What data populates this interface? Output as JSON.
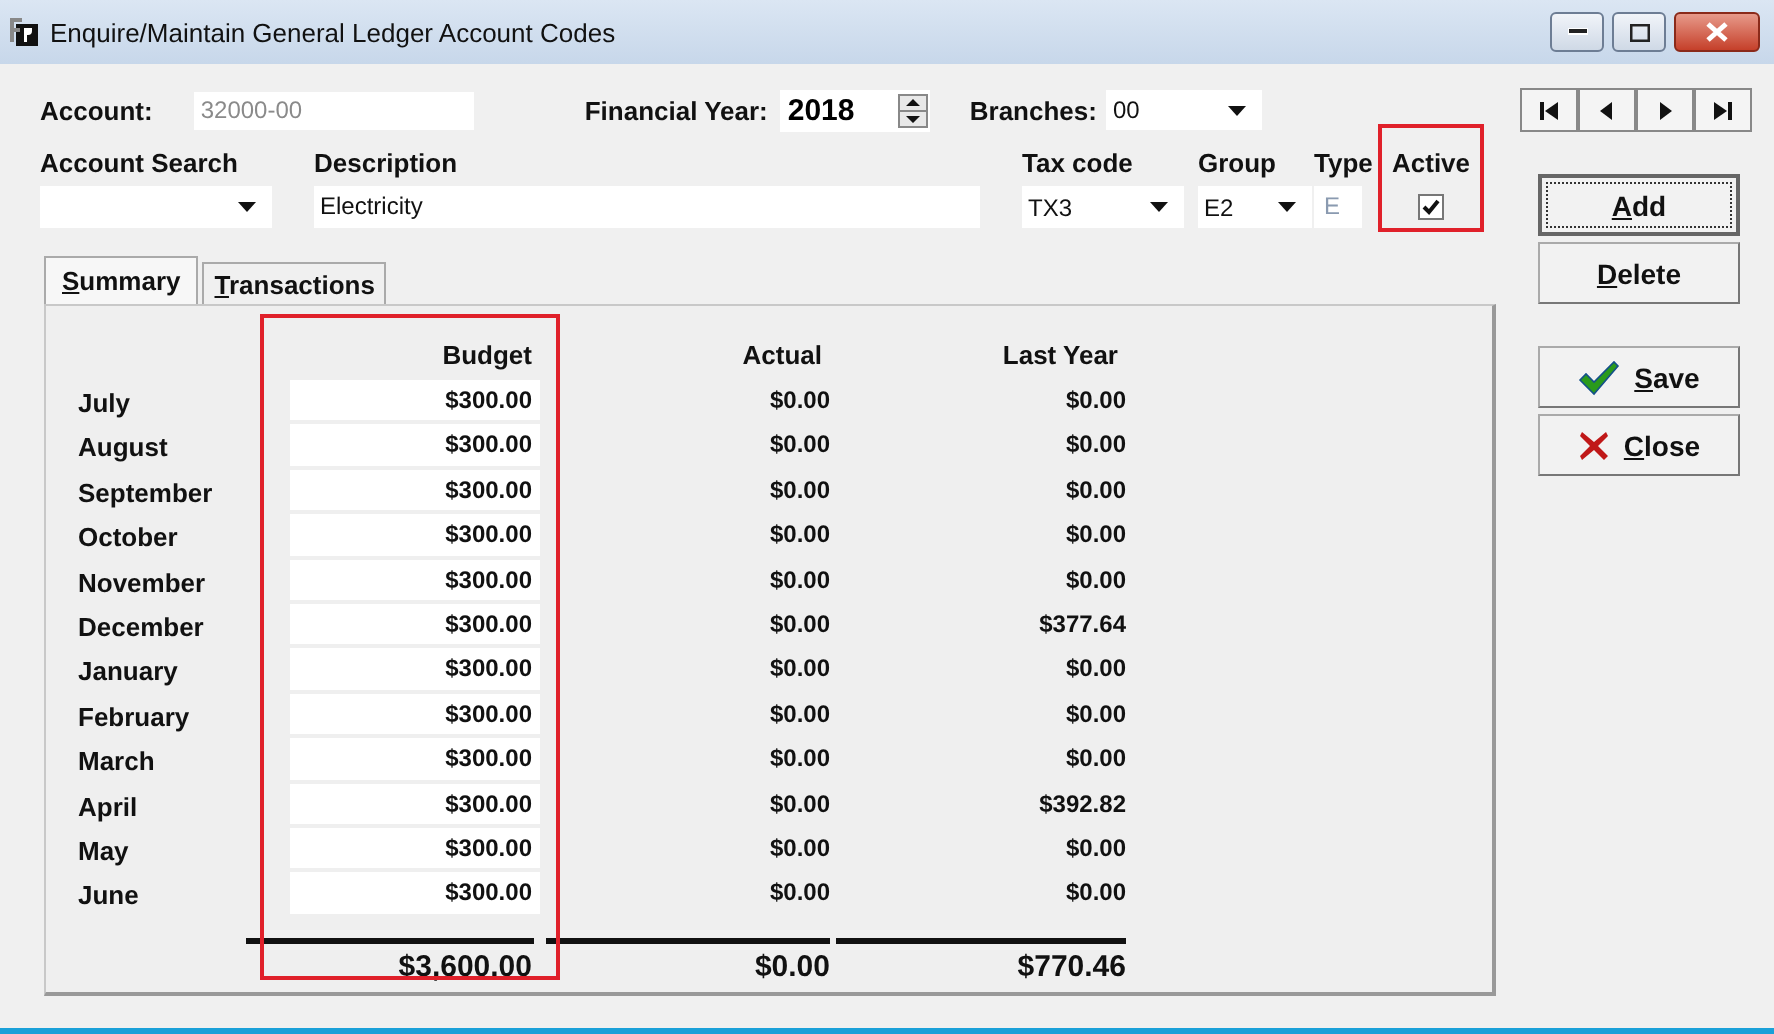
{
  "window": {
    "title": "Enquire/Maintain General Ledger Account Codes"
  },
  "header": {
    "account": {
      "label": "Account:",
      "value": "32000-00"
    },
    "financial_year": {
      "label": "Financial Year:",
      "value": "2018"
    },
    "branches": {
      "label": "Branches:",
      "value": "00"
    }
  },
  "fields": {
    "account_search": {
      "label": "Account Search"
    },
    "description": {
      "label": "Description",
      "value": "Electricity"
    },
    "tax_code": {
      "label": "Tax code",
      "value": "TX3"
    },
    "group": {
      "label": "Group",
      "value": "E2"
    },
    "type": {
      "label": "Type",
      "value": "E"
    },
    "active": {
      "label": "Active",
      "checked": true,
      "highlight": true
    }
  },
  "tabs": [
    {
      "label": "Summary",
      "selected": true
    },
    {
      "label": "Transactions",
      "selected": false
    }
  ],
  "table": {
    "columns": [
      "Budget",
      "Actual",
      "Last Year"
    ],
    "budget_highlight": true,
    "rows": [
      {
        "month": "July",
        "budget": "$300.00",
        "actual": "$0.00",
        "last_year": "$0.00"
      },
      {
        "month": "August",
        "budget": "$300.00",
        "actual": "$0.00",
        "last_year": "$0.00"
      },
      {
        "month": "September",
        "budget": "$300.00",
        "actual": "$0.00",
        "last_year": "$0.00"
      },
      {
        "month": "October",
        "budget": "$300.00",
        "actual": "$0.00",
        "last_year": "$0.00"
      },
      {
        "month": "November",
        "budget": "$300.00",
        "actual": "$0.00",
        "last_year": "$0.00"
      },
      {
        "month": "December",
        "budget": "$300.00",
        "actual": "$0.00",
        "last_year": "$377.64"
      },
      {
        "month": "January",
        "budget": "$300.00",
        "actual": "$0.00",
        "last_year": "$0.00"
      },
      {
        "month": "February",
        "budget": "$300.00",
        "actual": "$0.00",
        "last_year": "$0.00"
      },
      {
        "month": "March",
        "budget": "$300.00",
        "actual": "$0.00",
        "last_year": "$0.00"
      },
      {
        "month": "April",
        "budget": "$300.00",
        "actual": "$0.00",
        "last_year": "$392.82"
      },
      {
        "month": "May",
        "budget": "$300.00",
        "actual": "$0.00",
        "last_year": "$0.00"
      },
      {
        "month": "June",
        "budget": "$300.00",
        "actual": "$0.00",
        "last_year": "$0.00"
      }
    ],
    "totals": {
      "budget": "$3,600.00",
      "actual": "$0.00",
      "last_year": "$770.46"
    }
  },
  "buttons": [
    {
      "label": "Add",
      "kind": "plain",
      "focused": true
    },
    {
      "label": "Delete",
      "kind": "plain",
      "focused": false
    },
    {
      "label": "Save",
      "kind": "save",
      "focused": false
    },
    {
      "label": "Close",
      "kind": "close",
      "focused": false
    }
  ]
}
